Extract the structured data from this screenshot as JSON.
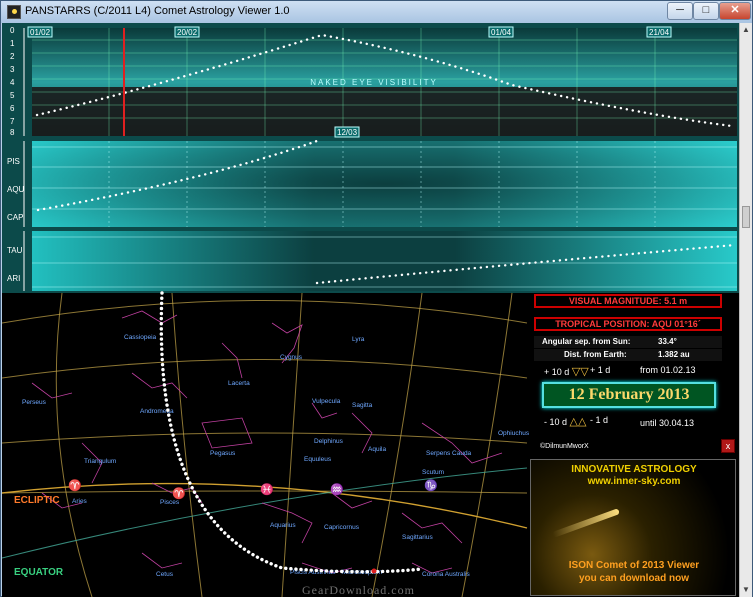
{
  "window": {
    "title": "PANSTARRS (C/2011 L4) Comet Astrology Viewer 1.0",
    "min_label": "─",
    "max_label": "□",
    "close_label": "✕"
  },
  "chart_visibility": {
    "y_ticks": [
      "0",
      "1",
      "2",
      "3",
      "4",
      "5",
      "6",
      "7",
      "8"
    ],
    "date_labels": [
      "01/02",
      "20/02",
      "01/04",
      "21/04"
    ],
    "center_label": "NAKED EYE VISIBILITY"
  },
  "chart_position1": {
    "marker_label": "12/03",
    "signs": [
      "PIS",
      "AQU",
      "CAP"
    ]
  },
  "chart_position2": {
    "signs": [
      "TAU",
      "ARI"
    ]
  },
  "starmap": {
    "constellations": [
      "Cassiopeia",
      "Cygnus",
      "Lyra",
      "Lacerta",
      "Vulpecula",
      "Sagitta",
      "Perseus",
      "Andromeda",
      "Pegasus",
      "Delphinus",
      "Aquila",
      "Ophiuchus",
      "Serpens Cauda",
      "Triangulum",
      "Equuleus",
      "Scutum",
      "Aries",
      "Pisces",
      "Aquarius",
      "Capricornus",
      "Sagittarius",
      "Piscis Austrinus",
      "Microscopium",
      "Cetus",
      "Corona Australis"
    ],
    "ecliptic_label": "ECLIPTIC",
    "equator_label": "EQUATOR"
  },
  "info": {
    "visual_magnitude": "VISUAL MAGNITUDE: 5.1 m",
    "tropical_position": "TROPICAL POSITION: AQU 01°16´",
    "angular_sep_label": "Angular sep. from Sun:",
    "angular_sep_value": "33.4°",
    "dist_label": "Dist. from Earth:",
    "dist_value": "1.382 au",
    "plus10": "+ 10 d",
    "plus1": "+ 1 d",
    "from_date": "from 01.02.13",
    "date": "12 February 2013",
    "minus10": "- 10 d",
    "minus1": "- 1 d",
    "until_date": "until 30.04.13",
    "credit": "©DilmunMworX",
    "close_x": "x"
  },
  "ad": {
    "line1": "INNOVATIVE ASTROLOGY",
    "line2": "www.inner-sky.com",
    "line3": "ISON Comet of 2013 Viewer",
    "line4": "you can download now"
  },
  "watermark": "GearDownload.com"
}
